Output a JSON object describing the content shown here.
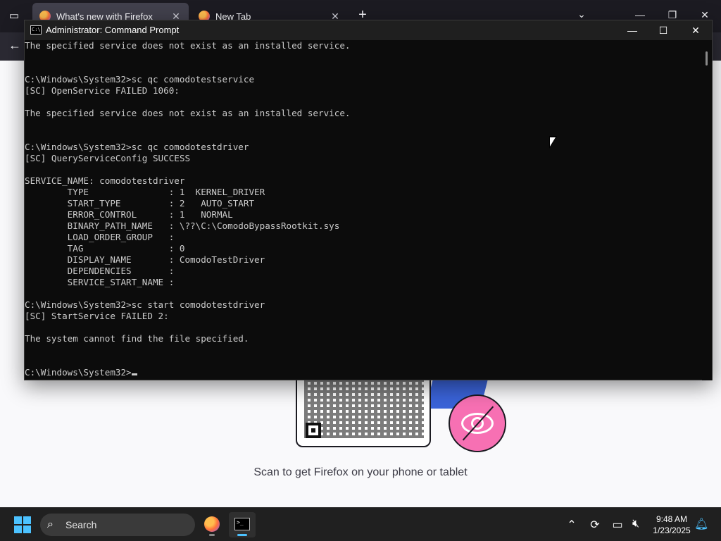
{
  "browser": {
    "tabs": [
      {
        "title": "What's new with Firefox",
        "active": true
      },
      {
        "title": "New Tab",
        "active": false
      }
    ],
    "new_tab_symbol": "+",
    "close_symbol": "✕"
  },
  "newtab": {
    "scan_text": "Scan to get Firefox on your phone or tablet"
  },
  "cmd": {
    "title": "Administrator: Command Prompt",
    "icon_text": "C:\\",
    "lines": [
      "The specified service does not exist as an installed service.",
      "",
      "",
      "C:\\Windows\\System32>sc qc comodotestservice",
      "[SC] OpenService FAILED 1060:",
      "",
      "The specified service does not exist as an installed service.",
      "",
      "",
      "C:\\Windows\\System32>sc qc comodotestdriver",
      "[SC] QueryServiceConfig SUCCESS",
      "",
      "SERVICE_NAME: comodotestdriver",
      "        TYPE               : 1  KERNEL_DRIVER",
      "        START_TYPE         : 2   AUTO_START",
      "        ERROR_CONTROL      : 1   NORMAL",
      "        BINARY_PATH_NAME   : \\??\\C:\\ComodoBypassRootkit.sys",
      "        LOAD_ORDER_GROUP   :",
      "        TAG                : 0",
      "        DISPLAY_NAME       : ComodoTestDriver",
      "        DEPENDENCIES       :",
      "        SERVICE_START_NAME :",
      "",
      "C:\\Windows\\System32>sc start comodotestdriver",
      "[SC] StartService FAILED 2:",
      "",
      "The system cannot find the file specified.",
      "",
      "",
      "C:\\Windows\\System32>"
    ]
  },
  "taskbar": {
    "search_label": "Search",
    "time": "9:48 AM",
    "date": "1/23/2025"
  },
  "colors": {
    "cmd_bg": "#0c0c0c",
    "cmd_text": "#cccccc",
    "taskbar_bg": "#202020",
    "accent": "#4cc2ff"
  }
}
